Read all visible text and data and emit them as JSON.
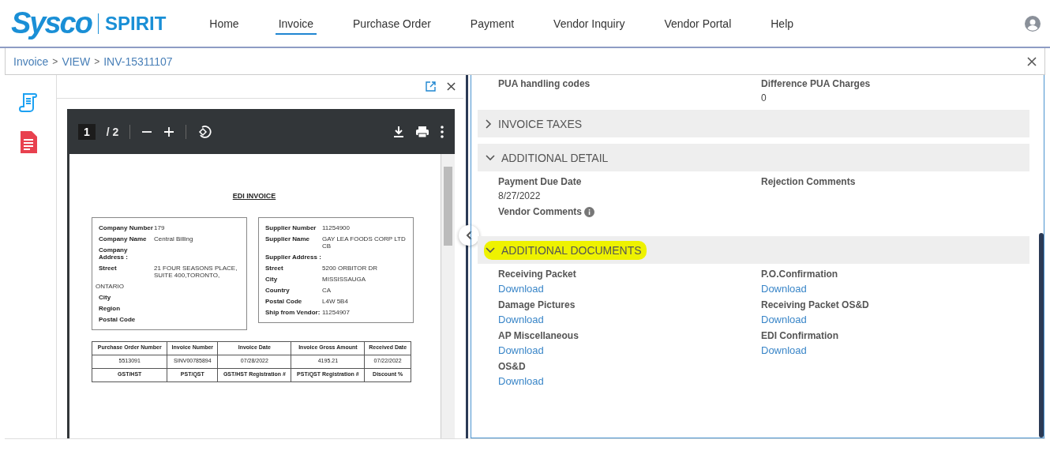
{
  "logo": {
    "brand": "Sysco",
    "product": "SPIRIT"
  },
  "nav": [
    {
      "label": "Home",
      "selected": false
    },
    {
      "label": "Invoice",
      "selected": true
    },
    {
      "label": "Purchase Order",
      "selected": false
    },
    {
      "label": "Payment",
      "selected": false
    },
    {
      "label": "Vendor Inquiry",
      "selected": false
    },
    {
      "label": "Vendor Portal",
      "selected": false
    },
    {
      "label": "Help",
      "selected": false
    }
  ],
  "breadcrumb": {
    "separator": ">",
    "items": [
      "Invoice",
      "VIEW",
      "INV-15311107"
    ]
  },
  "pdf_viewer": {
    "page": "1",
    "page_total": "/ 2",
    "document": {
      "title": "EDI INVOICE",
      "company_box": [
        {
          "label": "Company Number",
          "value": "179"
        },
        {
          "label": "Company Name",
          "value": "Central Billing"
        },
        {
          "label": "Company Address :"
        },
        {
          "label": "Street",
          "value": "21 FOUR SEASONS PLACE, SUITE 400,TORONTO,"
        },
        {
          "kind": "continuation",
          "value": "ONTARIO"
        },
        {
          "label": "City"
        },
        {
          "label": "Region"
        },
        {
          "label": "Postal Code"
        }
      ],
      "supplier_box": [
        {
          "label": "Supplier Number",
          "value": "11254900"
        },
        {
          "label": "Supplier Name",
          "value": "GAY LEA FOODS CORP LTD CB"
        },
        {
          "label": "Supplier Address :"
        },
        {
          "label": "Street",
          "value": "5200 ORBITOR DR"
        },
        {
          "label": "City",
          "value": "MISSISSAUGA"
        },
        {
          "label": "Country",
          "value": "CA"
        },
        {
          "label": "Postal Code",
          "value": "L4W 5B4"
        },
        {
          "label": "Ship from Vendor:",
          "value": "11254907"
        }
      ],
      "table_rows": [
        {
          "kind": "header",
          "cells": [
            "Purchase Order Number",
            "Invoice Number",
            "Invoice Date",
            "Invoice Gross Amount",
            "Received Date"
          ]
        },
        {
          "kind": "value",
          "cells": [
            "5513091",
            "SINV00785894",
            "07/28/2022",
            "4195.21",
            "07/22/2022"
          ]
        },
        {
          "kind": "header",
          "cells": [
            "GST/HST",
            "PST/QST",
            "GST/HST Registration #",
            "PST/QST Registration #",
            "Discount %"
          ]
        }
      ]
    }
  },
  "detail": {
    "top_fields": [
      {
        "label": "PUA handling codes"
      },
      {
        "label": "Difference PUA Charges",
        "value": "0"
      }
    ],
    "sections": [
      {
        "title": "INVOICE TAXES",
        "expanded": false,
        "highlighted": false
      },
      {
        "title": "ADDITIONAL DETAIL",
        "expanded": true,
        "highlighted": false,
        "fields": [
          {
            "label": "Payment Due Date",
            "value": "8/27/2022"
          },
          {
            "label": "Rejection Comments"
          },
          {
            "label": "Vendor Comments",
            "info": true
          }
        ]
      },
      {
        "title": "ADDITIONAL DOCUMENTS",
        "expanded": true,
        "highlighted": true,
        "fields": [
          {
            "label": "Receiving Packet",
            "link": "Download"
          },
          {
            "label": "P.O.Confirmation",
            "link": "Download"
          },
          {
            "label": "Damage Pictures",
            "link": "Download"
          },
          {
            "label": "Receiving Packet OS&D",
            "link": "Download"
          },
          {
            "label": "AP Miscellaneous",
            "link": "Download"
          },
          {
            "label": "EDI Confirmation",
            "link": "Download"
          },
          {
            "label": "OS&D",
            "link": "Download"
          }
        ]
      }
    ]
  }
}
